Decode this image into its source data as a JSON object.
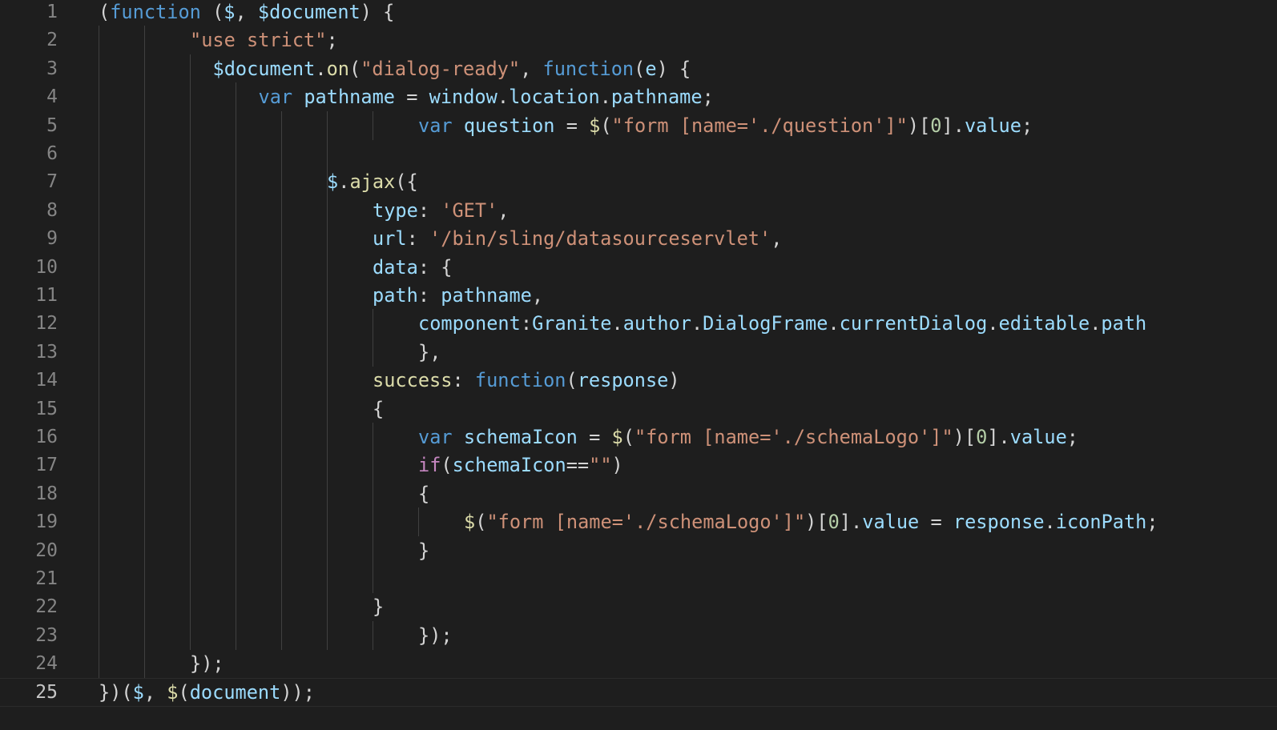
{
  "editor": {
    "language": "javascript",
    "theme_colors": {
      "background": "#1e1e1e",
      "line_number": "#858585",
      "line_number_active": "#c6c6c6",
      "keyword": "#569cd6",
      "control": "#c586c0",
      "string": "#ce9178",
      "number": "#b5cea8",
      "variable": "#9cdcfe",
      "function": "#dcdcaa",
      "punctuation": "#d4d4d4",
      "indent_guide": "#404040"
    },
    "current_line": 25,
    "lines": [
      {
        "n": "1",
        "guides": [],
        "indent": 0,
        "tokens": [
          [
            "pun",
            "("
          ],
          [
            "kw",
            "function"
          ],
          [
            "pun",
            " ("
          ],
          [
            "var",
            "$"
          ],
          [
            "pun",
            ", "
          ],
          [
            "var",
            "$document"
          ],
          [
            "pun",
            ") {"
          ]
        ]
      },
      {
        "n": "2",
        "guides": [
          0,
          1
        ],
        "indent": 2,
        "tokens": [
          [
            "str",
            "\"use strict\""
          ],
          [
            "pun",
            ";"
          ]
        ]
      },
      {
        "n": "3",
        "guides": [
          0,
          1,
          2
        ],
        "indent": 2.5,
        "tokens": [
          [
            "var",
            "$document"
          ],
          [
            "pun",
            "."
          ],
          [
            "fn",
            "on"
          ],
          [
            "pun",
            "("
          ],
          [
            "str",
            "\"dialog-ready\""
          ],
          [
            "pun",
            ", "
          ],
          [
            "kw",
            "function"
          ],
          [
            "pun",
            "("
          ],
          [
            "var",
            "e"
          ],
          [
            "pun",
            ") {"
          ]
        ]
      },
      {
        "n": "4",
        "guides": [
          0,
          1,
          2,
          3
        ],
        "indent": 3.5,
        "tokens": [
          [
            "kw",
            "var"
          ],
          [
            "pun",
            " "
          ],
          [
            "var",
            "pathname"
          ],
          [
            "pun",
            " = "
          ],
          [
            "var",
            "window"
          ],
          [
            "pun",
            "."
          ],
          [
            "var",
            "location"
          ],
          [
            "pun",
            "."
          ],
          [
            "var",
            "pathname"
          ],
          [
            "pun",
            ";"
          ]
        ]
      },
      {
        "n": "5",
        "guides": [
          0,
          1,
          2,
          3,
          4,
          5,
          6
        ],
        "indent": 7,
        "tokens": [
          [
            "kw",
            "var"
          ],
          [
            "pun",
            " "
          ],
          [
            "var",
            "question"
          ],
          [
            "pun",
            " = "
          ],
          [
            "fn",
            "$"
          ],
          [
            "pun",
            "("
          ],
          [
            "str",
            "\"form [name='./question']\""
          ],
          [
            "pun",
            ")["
          ],
          [
            "num",
            "0"
          ],
          [
            "pun",
            "]."
          ],
          [
            "var",
            "value"
          ],
          [
            "pun",
            ";"
          ]
        ]
      },
      {
        "n": "6",
        "guides": [
          0,
          1,
          2,
          3,
          4,
          5
        ],
        "indent": 0,
        "tokens": []
      },
      {
        "n": "7",
        "guides": [
          0,
          1,
          2,
          3,
          4,
          5
        ],
        "indent": 5,
        "tokens": [
          [
            "var",
            "$"
          ],
          [
            "pun",
            "."
          ],
          [
            "fn",
            "ajax"
          ],
          [
            "pun",
            "({"
          ]
        ]
      },
      {
        "n": "8",
        "guides": [
          0,
          1,
          2,
          3,
          4,
          5
        ],
        "indent": 6,
        "tokens": [
          [
            "var",
            "type"
          ],
          [
            "pun",
            ": "
          ],
          [
            "str",
            "'GET'"
          ],
          [
            "pun",
            ","
          ]
        ]
      },
      {
        "n": "9",
        "guides": [
          0,
          1,
          2,
          3,
          4,
          5
        ],
        "indent": 6,
        "tokens": [
          [
            "var",
            "url"
          ],
          [
            "pun",
            ": "
          ],
          [
            "str",
            "'/bin/sling/datasourceservlet'"
          ],
          [
            "pun",
            ","
          ]
        ]
      },
      {
        "n": "10",
        "guides": [
          0,
          1,
          2,
          3,
          4,
          5
        ],
        "indent": 6,
        "tokens": [
          [
            "var",
            "data"
          ],
          [
            "pun",
            ": {"
          ]
        ]
      },
      {
        "n": "11",
        "guides": [
          0,
          1,
          2,
          3,
          4,
          5
        ],
        "indent": 6,
        "tokens": [
          [
            "var",
            "path"
          ],
          [
            "pun",
            ": "
          ],
          [
            "var",
            "pathname"
          ],
          [
            "pun",
            ","
          ]
        ]
      },
      {
        "n": "12",
        "guides": [
          0,
          1,
          2,
          3,
          4,
          5,
          6
        ],
        "indent": 7,
        "tokens": [
          [
            "var",
            "component"
          ],
          [
            "pun",
            ":"
          ],
          [
            "var",
            "Granite"
          ],
          [
            "pun",
            "."
          ],
          [
            "var",
            "author"
          ],
          [
            "pun",
            "."
          ],
          [
            "var",
            "DialogFrame"
          ],
          [
            "pun",
            "."
          ],
          [
            "var",
            "currentDialog"
          ],
          [
            "pun",
            "."
          ],
          [
            "var",
            "editable"
          ],
          [
            "pun",
            "."
          ],
          [
            "var",
            "path"
          ]
        ]
      },
      {
        "n": "13",
        "guides": [
          0,
          1,
          2,
          3,
          4,
          5,
          6
        ],
        "indent": 7,
        "tokens": [
          [
            "pun",
            "},"
          ]
        ]
      },
      {
        "n": "14",
        "guides": [
          0,
          1,
          2,
          3,
          4,
          5
        ],
        "indent": 6,
        "tokens": [
          [
            "fn",
            "success"
          ],
          [
            "pun",
            ": "
          ],
          [
            "kw",
            "function"
          ],
          [
            "pun",
            "("
          ],
          [
            "var",
            "response"
          ],
          [
            "pun",
            ")"
          ]
        ]
      },
      {
        "n": "15",
        "guides": [
          0,
          1,
          2,
          3,
          4,
          5
        ],
        "indent": 6,
        "tokens": [
          [
            "pun",
            "{"
          ]
        ]
      },
      {
        "n": "16",
        "guides": [
          0,
          1,
          2,
          3,
          4,
          5,
          6
        ],
        "indent": 7,
        "tokens": [
          [
            "kw",
            "var"
          ],
          [
            "pun",
            " "
          ],
          [
            "var",
            "schemaIcon"
          ],
          [
            "pun",
            " = "
          ],
          [
            "fn",
            "$"
          ],
          [
            "pun",
            "("
          ],
          [
            "str",
            "\"form [name='./schemaLogo']\""
          ],
          [
            "pun",
            ")["
          ],
          [
            "num",
            "0"
          ],
          [
            "pun",
            "]."
          ],
          [
            "var",
            "value"
          ],
          [
            "pun",
            ";"
          ]
        ]
      },
      {
        "n": "17",
        "guides": [
          0,
          1,
          2,
          3,
          4,
          5,
          6
        ],
        "indent": 7,
        "tokens": [
          [
            "ctl",
            "if"
          ],
          [
            "pun",
            "("
          ],
          [
            "var",
            "schemaIcon"
          ],
          [
            "pun",
            "=="
          ],
          [
            "str",
            "\"\""
          ],
          [
            "pun",
            ")"
          ]
        ]
      },
      {
        "n": "18",
        "guides": [
          0,
          1,
          2,
          3,
          4,
          5,
          6
        ],
        "indent": 7,
        "tokens": [
          [
            "pun",
            "{"
          ]
        ]
      },
      {
        "n": "19",
        "guides": [
          0,
          1,
          2,
          3,
          4,
          5,
          6,
          7
        ],
        "indent": 8,
        "tokens": [
          [
            "fn",
            "$"
          ],
          [
            "pun",
            "("
          ],
          [
            "str",
            "\"form [name='./schemaLogo']\""
          ],
          [
            "pun",
            ")["
          ],
          [
            "num",
            "0"
          ],
          [
            "pun",
            "]."
          ],
          [
            "var",
            "value"
          ],
          [
            "pun",
            " = "
          ],
          [
            "var",
            "response"
          ],
          [
            "pun",
            "."
          ],
          [
            "var",
            "iconPath"
          ],
          [
            "pun",
            ";"
          ]
        ]
      },
      {
        "n": "20",
        "guides": [
          0,
          1,
          2,
          3,
          4,
          5,
          6
        ],
        "indent": 7,
        "tokens": [
          [
            "pun",
            "}"
          ]
        ]
      },
      {
        "n": "21",
        "guides": [
          0,
          1,
          2,
          3,
          4,
          5,
          6
        ],
        "indent": 0,
        "tokens": []
      },
      {
        "n": "22",
        "guides": [
          0,
          1,
          2,
          3,
          4,
          5
        ],
        "indent": 6,
        "tokens": [
          [
            "pun",
            "}"
          ]
        ]
      },
      {
        "n": "23",
        "guides": [
          0,
          1,
          2,
          3,
          4,
          5,
          6
        ],
        "indent": 7,
        "tokens": [
          [
            "pun",
            "});"
          ]
        ]
      },
      {
        "n": "24",
        "guides": [
          0,
          1
        ],
        "indent": 2,
        "tokens": [
          [
            "pun",
            "});"
          ]
        ]
      },
      {
        "n": "25",
        "guides": [],
        "indent": 0,
        "tokens": [
          [
            "pun",
            "})("
          ],
          [
            "var",
            "$"
          ],
          [
            "pun",
            ", "
          ],
          [
            "fn",
            "$"
          ],
          [
            "pun",
            "("
          ],
          [
            "var",
            "document"
          ],
          [
            "pun",
            "));"
          ]
        ]
      }
    ]
  }
}
